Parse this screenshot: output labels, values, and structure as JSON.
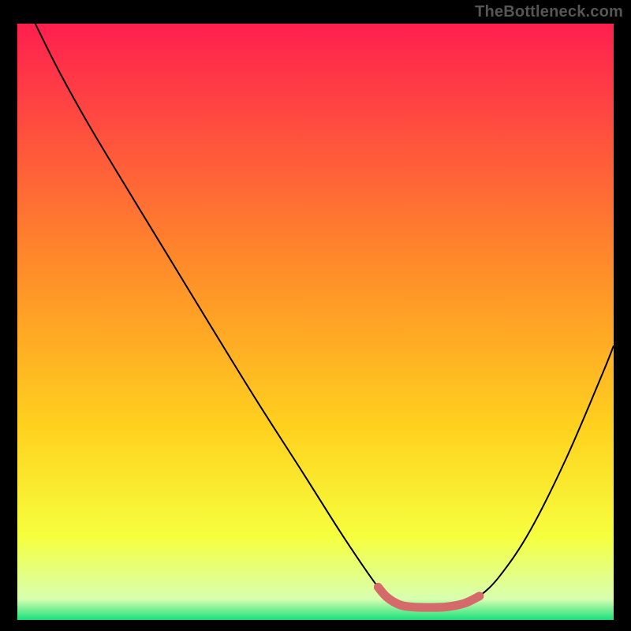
{
  "attribution": "TheBottleneck.com",
  "chart_data": {
    "type": "line",
    "title": "",
    "xlabel": "",
    "ylabel": "",
    "xlim": [
      0,
      100
    ],
    "ylim": [
      0,
      100
    ],
    "grid": false,
    "legend": false,
    "series": [
      {
        "name": "bottleneck-curve",
        "color": "#000000",
        "stroke_width": 2,
        "x": [
          3,
          7,
          12,
          18,
          25,
          32,
          40,
          48,
          54,
          58,
          60.5,
          62,
          64,
          66,
          69,
          72,
          75,
          77.5,
          81,
          86,
          92,
          98,
          100
        ],
        "y": [
          100,
          92,
          83,
          73,
          61.5,
          50,
          37,
          24.5,
          15,
          9,
          5.5,
          3.8,
          2.6,
          2.2,
          2.1,
          2.2,
          2.8,
          4,
          7.5,
          15,
          27,
          41,
          46
        ]
      },
      {
        "name": "highlight-segment",
        "color": "#d46a6a",
        "stroke_width": 11,
        "x": [
          60.5,
          62,
          64,
          66,
          69,
          72,
          75,
          77.5
        ],
        "y": [
          5.5,
          3.8,
          2.6,
          2.2,
          2.1,
          2.2,
          2.8,
          4
        ]
      }
    ],
    "background_gradient": {
      "direction": "vertical",
      "stops": [
        {
          "offset": 0.0,
          "color": "#ff1f4f"
        },
        {
          "offset": 0.4,
          "color": "#ff8a2a"
        },
        {
          "offset": 0.68,
          "color": "#ffd21e"
        },
        {
          "offset": 0.86,
          "color": "#f6ff3e"
        },
        {
          "offset": 0.965,
          "color": "#d8ffb0"
        },
        {
          "offset": 1.0,
          "color": "#18e07a"
        }
      ]
    }
  }
}
